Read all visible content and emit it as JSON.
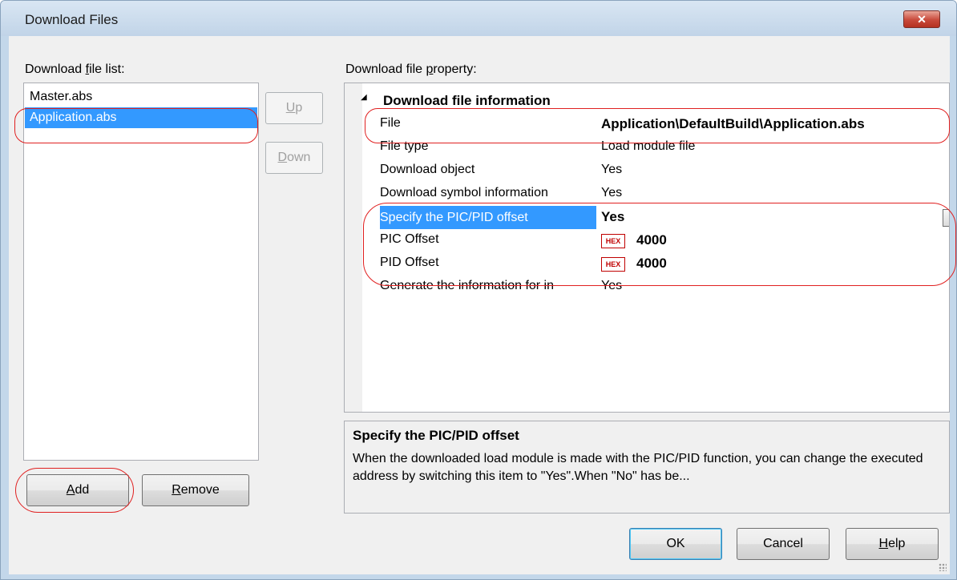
{
  "window": {
    "title": "Download Files",
    "close_glyph": "✕"
  },
  "file_list": {
    "label_pre": "Download ",
    "label_accel": "f",
    "label_post": "ile list:",
    "items": [
      {
        "label": "Master.abs",
        "selected": false
      },
      {
        "label": "Application.abs",
        "selected": true
      }
    ]
  },
  "side_buttons": {
    "up_accel": "U",
    "up_rest": "p",
    "down_accel": "D",
    "down_rest": "own"
  },
  "bottom_left_buttons": {
    "add_accel": "A",
    "add_rest": "dd",
    "remove_accel": "R",
    "remove_rest": "emove"
  },
  "property": {
    "label_pre": "Download file ",
    "label_accel": "p",
    "label_post": "roperty:",
    "category": "Download file information",
    "category_toggle": "◢",
    "rows": [
      {
        "name": "File",
        "value": "Application\\DefaultBuild\\Application.abs"
      },
      {
        "name": "File type",
        "value": "Load module file"
      },
      {
        "name": "Download object",
        "value": "Yes"
      },
      {
        "name": "Download symbol information",
        "value": "Yes"
      },
      {
        "name": "Specify the PIC/PID offset",
        "value": "Yes"
      },
      {
        "name": "PIC Offset",
        "hex": "HEX",
        "value": "4000"
      },
      {
        "name": "PID Offset",
        "hex": "HEX",
        "value": "4000"
      },
      {
        "name": "Generate the information for in",
        "value": "Yes"
      }
    ],
    "dropdown_glyph": "▼"
  },
  "description": {
    "title": "Specify the PIC/PID offset",
    "text": "When the downloaded load module is made with the PIC/PID function, you can change the executed address by switching this item to \"Yes\".When \"No\" has be..."
  },
  "dialog_buttons": {
    "ok": "OK",
    "cancel": "Cancel",
    "help_accel": "H",
    "help_rest": "elp"
  },
  "colors": {
    "selection": "#3399ff",
    "highlight_ring": "#e02020",
    "hex_badge": "#c00000"
  }
}
